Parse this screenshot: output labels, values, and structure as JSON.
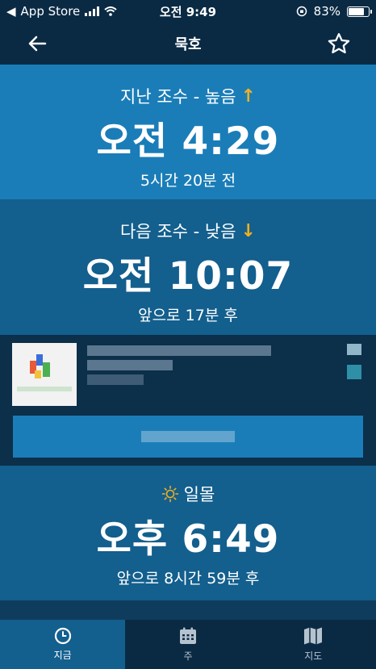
{
  "status": {
    "back_app": "App Store",
    "time": "오전 9:49",
    "battery": "83%",
    "battery_level": 0.83
  },
  "nav": {
    "title": "묵호",
    "back_icon": "arrow-left-icon",
    "favorite_icon": "star-outline-icon"
  },
  "last_tide": {
    "label": "지난 조수 - 높음",
    "arrow": "↑",
    "time": "오전 4:29",
    "relative": "5시간 20분 전"
  },
  "next_tide": {
    "label": "다음 조수 - 낮음",
    "arrow": "↓",
    "time": "오전 10:07",
    "relative": "앞으로 17분 후"
  },
  "sunset": {
    "icon": "sun-icon",
    "label": "일몰",
    "time": "오후 6:49",
    "relative": "앞으로 8시간 59분 후"
  },
  "tabs": [
    {
      "label": "지금",
      "icon": "clock-icon",
      "active": true
    },
    {
      "label": "주",
      "icon": "calendar-icon",
      "active": false
    },
    {
      "label": "지도",
      "icon": "map-icon",
      "active": false
    }
  ],
  "colors": {
    "accent_arrow": "#f2b01e",
    "header": "#0a2a44",
    "panel_light": "#1a7db8",
    "panel_dark": "#135f8e"
  }
}
